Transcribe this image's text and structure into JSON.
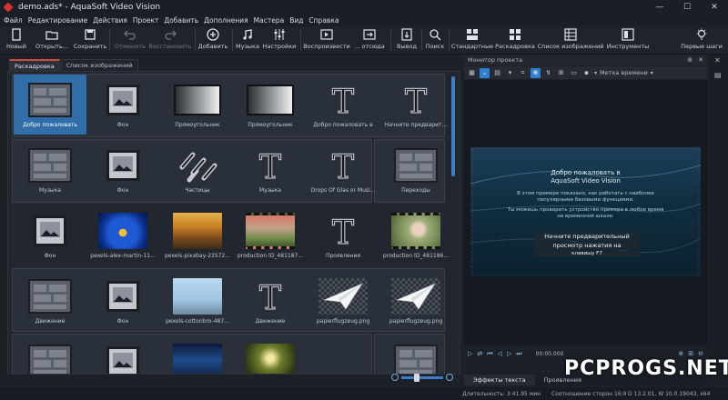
{
  "window": {
    "title": "demo.ads* - AquaSoft Video Vision",
    "controls": [
      "—",
      "☐",
      "✕"
    ]
  },
  "menu": [
    "Файл",
    "Редактирование",
    "Действия",
    "Проект",
    "Добавить",
    "Дополнения",
    "Мастера",
    "Вид",
    "Справка"
  ],
  "toolbar": {
    "new": "Новый",
    "open": "Открыть...",
    "save": "Сохранить",
    "undo": "Отменить",
    "redo": "Восстановить",
    "add": "Добавить",
    "music": "Музыка",
    "settings": "Настройки",
    "play": "Воспроизвести",
    "from": "... отсюда",
    "export": "Вывод",
    "search": "Поиск",
    "standard": "Стандартные",
    "storyboard": "Раскадровка",
    "image_list": "Список изображений",
    "tools": "Инструменты",
    "first_steps": "Первые шаги"
  },
  "left_tabs": {
    "storyboard": "Раскадровка",
    "image_list": "Список изображений"
  },
  "storyboard": {
    "row1": [
      {
        "caption": "Добро пожаловать",
        "kind": "chapter",
        "selected": true
      },
      {
        "caption": "Фон",
        "kind": "bg"
      },
      {
        "caption": "Прямоугольник",
        "kind": "rect"
      },
      {
        "caption": "Прямоугольник",
        "kind": "rect"
      },
      {
        "caption": "Добро пожаловать в",
        "kind": "text"
      },
      {
        "caption": "Начните предварит...",
        "kind": "text"
      }
    ],
    "row2": [
      {
        "caption": "Музыка",
        "kind": "chapter"
      },
      {
        "caption": "Фон",
        "kind": "bg"
      },
      {
        "caption": "Частицы",
        "kind": "particles"
      },
      {
        "caption": "Музыка",
        "kind": "text"
      },
      {
        "caption": "Drops Of Glas or Musi...",
        "kind": "text"
      },
      {
        "caption": "Переходы",
        "kind": "chapter"
      }
    ],
    "row3": [
      {
        "caption": "Фон",
        "kind": "bg"
      },
      {
        "caption": "pexels-alex-martin-11...",
        "kind": "flower"
      },
      {
        "caption": "pexels-pixabay-23572...",
        "kind": "autumn"
      },
      {
        "caption": "production ID_481187...",
        "kind": "picnic"
      },
      {
        "caption": "Проявления",
        "kind": "text"
      },
      {
        "caption": "production ID_481186...",
        "kind": "baby"
      }
    ],
    "row4": [
      {
        "caption": "Движение",
        "kind": "chapter"
      },
      {
        "caption": "Фон",
        "kind": "bg"
      },
      {
        "caption": "pexels-cottonbro-487...",
        "kind": "couple"
      },
      {
        "caption": "Движение",
        "kind": "text"
      },
      {
        "caption": "papierflugzeug.png",
        "kind": "plane"
      },
      {
        "caption": "papierflugzeug.png",
        "kind": "plane"
      }
    ],
    "row5": [
      {
        "kind": "chapter"
      },
      {
        "kind": "bg"
      },
      {
        "kind": "night"
      },
      {
        "kind": "forest"
      },
      {
        "kind": "empty"
      },
      {
        "kind": "chapter"
      }
    ]
  },
  "monitor": {
    "title": "Монитор проекта",
    "time_label": "Метка времени",
    "preview_title": "Добро пожаловать в",
    "preview_subtitle": "AquaSoft Video Vision",
    "preview_text1": "В этом примере показано, как работать с наиболее популярными базовыми функциями.",
    "preview_text2": "Ты можешь проверить устройство примера в любое время на временной шкале.",
    "preview_box1": "Начните предварительный",
    "preview_box2": "просмотр нажатия на",
    "preview_box3": "клавишу F7",
    "timecode": "00:00.000"
  },
  "right_tabs": {
    "text_effects": "Эффекты текста",
    "appearances": "Проявления"
  },
  "status": {
    "duration": "Длительность: 3:41.95 мин",
    "aspect": "Соотношение сторон 16:9",
    "version": "D 13.2.01, W 10.0.19043, x64"
  },
  "watermark": "PCPROGS.NET"
}
